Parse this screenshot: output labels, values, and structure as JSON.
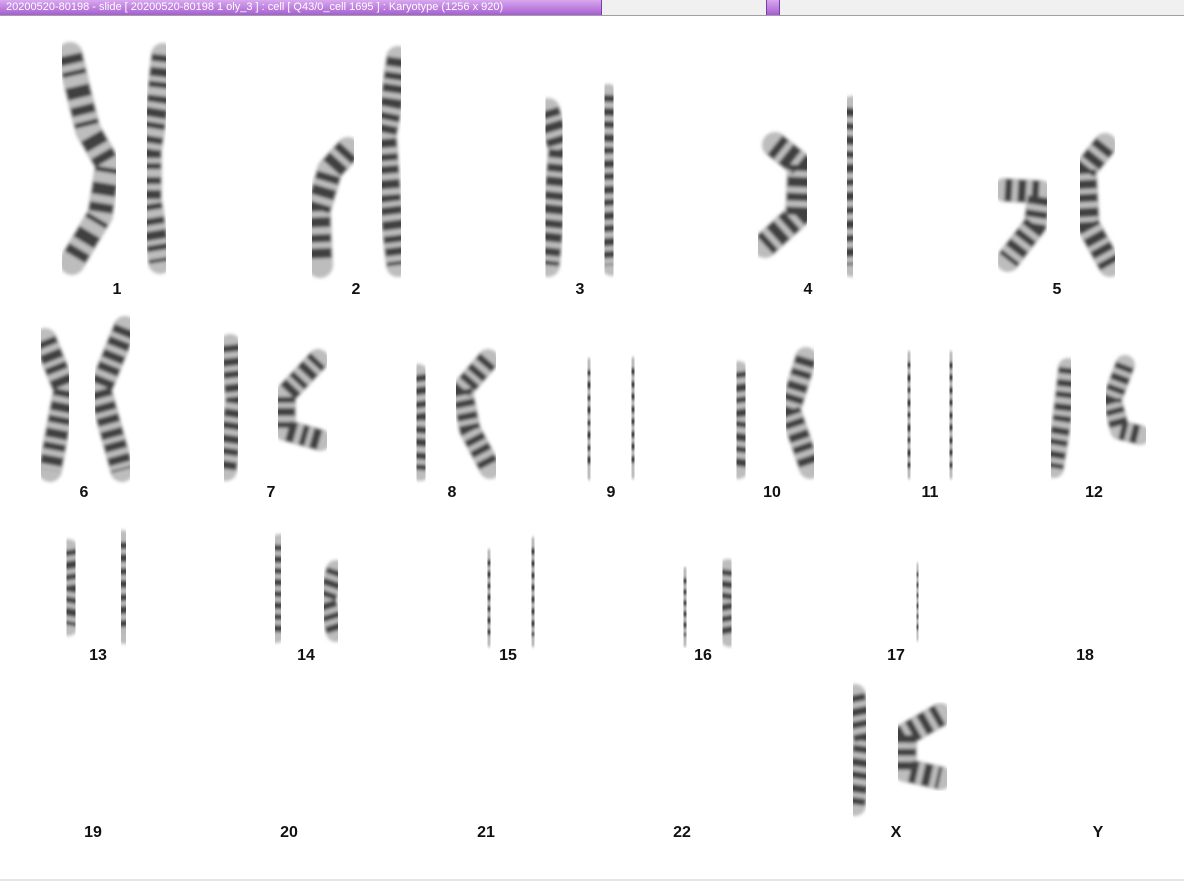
{
  "window": {
    "title": "20200520-80198 - slide [ 20200520-80198 1 oly_3 ] : cell [ Q43/0_cell 1695 ] : Karyotype  (1256 x 920)"
  },
  "karyotype": {
    "labels": [
      "1",
      "2",
      "3",
      "4",
      "5",
      "6",
      "7",
      "8",
      "9",
      "10",
      "11",
      "12",
      "13",
      "14",
      "15",
      "16",
      "17",
      "18",
      "19",
      "20",
      "21",
      "22",
      "X",
      "Y"
    ]
  },
  "colors": {
    "accent": "#b57be0",
    "chromosome_dark": "#2a2a2a",
    "chromosome_light": "#bdbdbd"
  }
}
